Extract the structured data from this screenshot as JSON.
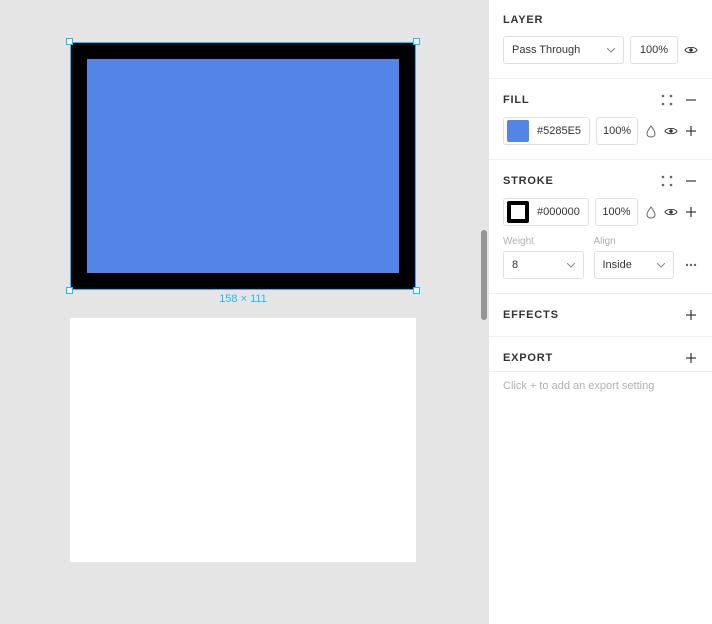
{
  "canvas": {
    "selection_dimensions": "158 × 111",
    "fill_color": "#5285E5",
    "stroke_color": "#000000"
  },
  "panel": {
    "layer": {
      "title": "LAYER",
      "blend_mode": "Pass Through",
      "opacity": "100%"
    },
    "fill": {
      "title": "FILL",
      "hex": "#5285E5",
      "opacity": "100%"
    },
    "stroke": {
      "title": "STROKE",
      "hex": "#000000",
      "opacity": "100%",
      "weight_label": "Weight",
      "align_label": "Align",
      "weight": "8",
      "align": "Inside"
    },
    "effects": {
      "title": "EFFECTS"
    },
    "export": {
      "title": "EXPORT",
      "hint": "Click + to add an export setting"
    }
  }
}
